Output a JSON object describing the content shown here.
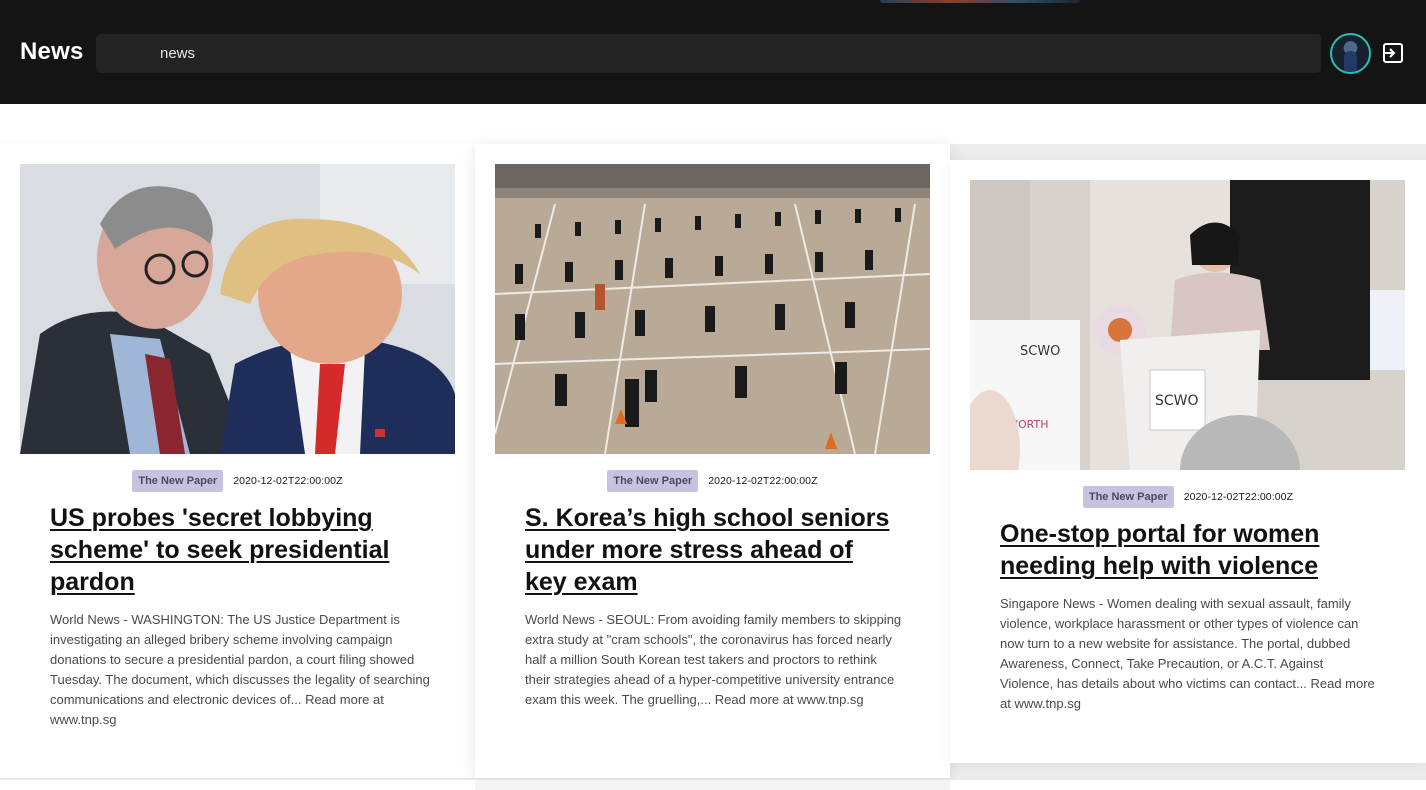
{
  "header": {
    "brand": "News",
    "search_value": "news",
    "avatar_label": "user-avatar",
    "logout_icon": "logout-icon"
  },
  "articles": [
    {
      "image_icon": "photo-two-men-suits",
      "source": "The New Paper",
      "date": "2020-12-02T22:00:00Z",
      "title": "US probes 'secret lobbying scheme' to seek presidential pardon",
      "summary": "World News - WASHINGTON: The US Justice Department is investigating an alleged bribery scheme involving campaign donations to secure a presidential pardon, a court filing showed Tuesday. The document, which discusses the legality of searching communications and electronic devices of... Read more at www.tnp.sg"
    },
    {
      "image_icon": "photo-students-field",
      "source": "The New Paper",
      "date": "2020-12-02T22:00:00Z",
      "title": "S. Korea’s high school seniors under more stress ahead of key exam",
      "summary": "World News - SEOUL: From avoiding family members to skipping extra study at \"cram schools\", the coronavirus has forced nearly half a million South Korean test takers and proctors to rethink their strategies ahead of a hyper-competitive university entrance exam this week. The gruelling,... Read more at www.tnp.sg"
    },
    {
      "image_icon": "photo-speaker-podium",
      "source": "The New Paper",
      "date": "2020-12-02T22:00:00Z",
      "title": "One-stop portal for women needing help with violence",
      "summary": "Singapore News - Women dealing with sexual assault, family violence, workplace harassment or other types of violence can now turn to a new website for assistance. The portal, dubbed Awareness, Connect, Take Precaution, or A.C.T. Against Violence, has details about who victims can contact... Read more at www.tnp.sg"
    }
  ],
  "colors": {
    "header_bg": "#141414",
    "badge_bg": "#c7c3df",
    "avatar_ring": "#2bbfb1"
  }
}
